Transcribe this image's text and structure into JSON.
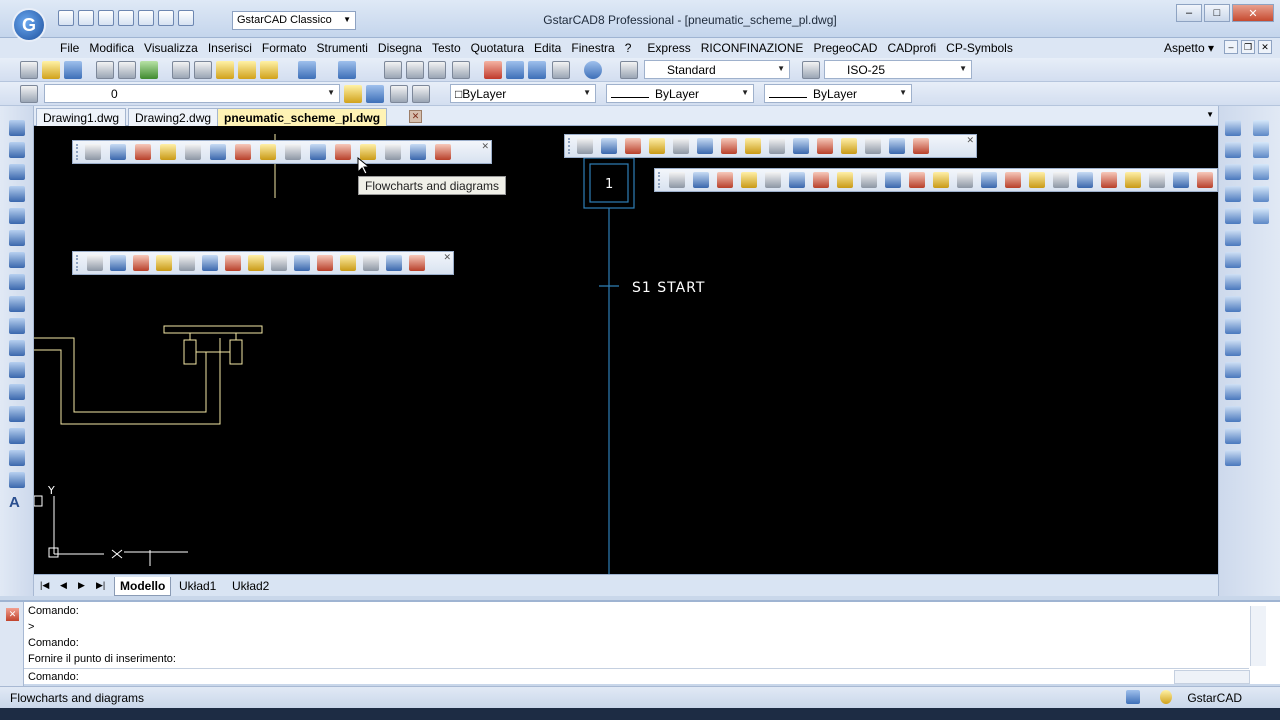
{
  "app": {
    "title": "GstarCAD8 Professional - [pneumatic_scheme_pl.dwg]",
    "workspace": "GstarCAD Classico",
    "logo": "G"
  },
  "menu": {
    "items": [
      "File",
      "Modifica",
      "Visualizza",
      "Inserisci",
      "Formato",
      "Strumenti",
      "Disegna",
      "Testo",
      "Quotatura",
      "Edita",
      "Finestra",
      "?",
      "Express",
      "RICONFINAZIONE",
      "PregeoCAD",
      "CADprofi",
      "CP-Symbols"
    ],
    "aspetto": "Aspetto"
  },
  "toolbar": {
    "text_style": "Standard",
    "dim_style": "ISO-25",
    "layer": "0",
    "color": "ByLayer",
    "linetype": "ByLayer",
    "lineweight": "ByLayer"
  },
  "drawing_tabs": [
    "Drawing1.dwg",
    "Drawing2.dwg",
    "pneumatic_scheme_pl.dwg"
  ],
  "active_drawing_tab": "pneumatic_scheme_pl.dwg",
  "canvas": {
    "block_number": "1",
    "label": "S1 START",
    "axis_y": "Y"
  },
  "tooltip": "Flowcharts and diagrams",
  "layout_tabs": [
    "Modello",
    "Układ1",
    "Układ2"
  ],
  "command": {
    "lines": [
      "Comando:",
      ">",
      "Comando:",
      "Fornire il punto di inserimento:"
    ],
    "prompt": "Comando:"
  },
  "status": {
    "text": "Flowcharts and diagrams",
    "app_name": "GstarCAD"
  },
  "colors": {
    "canvas_bg": "#000000",
    "drawing_line": "#f4e7a6",
    "axis_line": "#2f7fb7",
    "active_tab": "#fff3b5"
  }
}
